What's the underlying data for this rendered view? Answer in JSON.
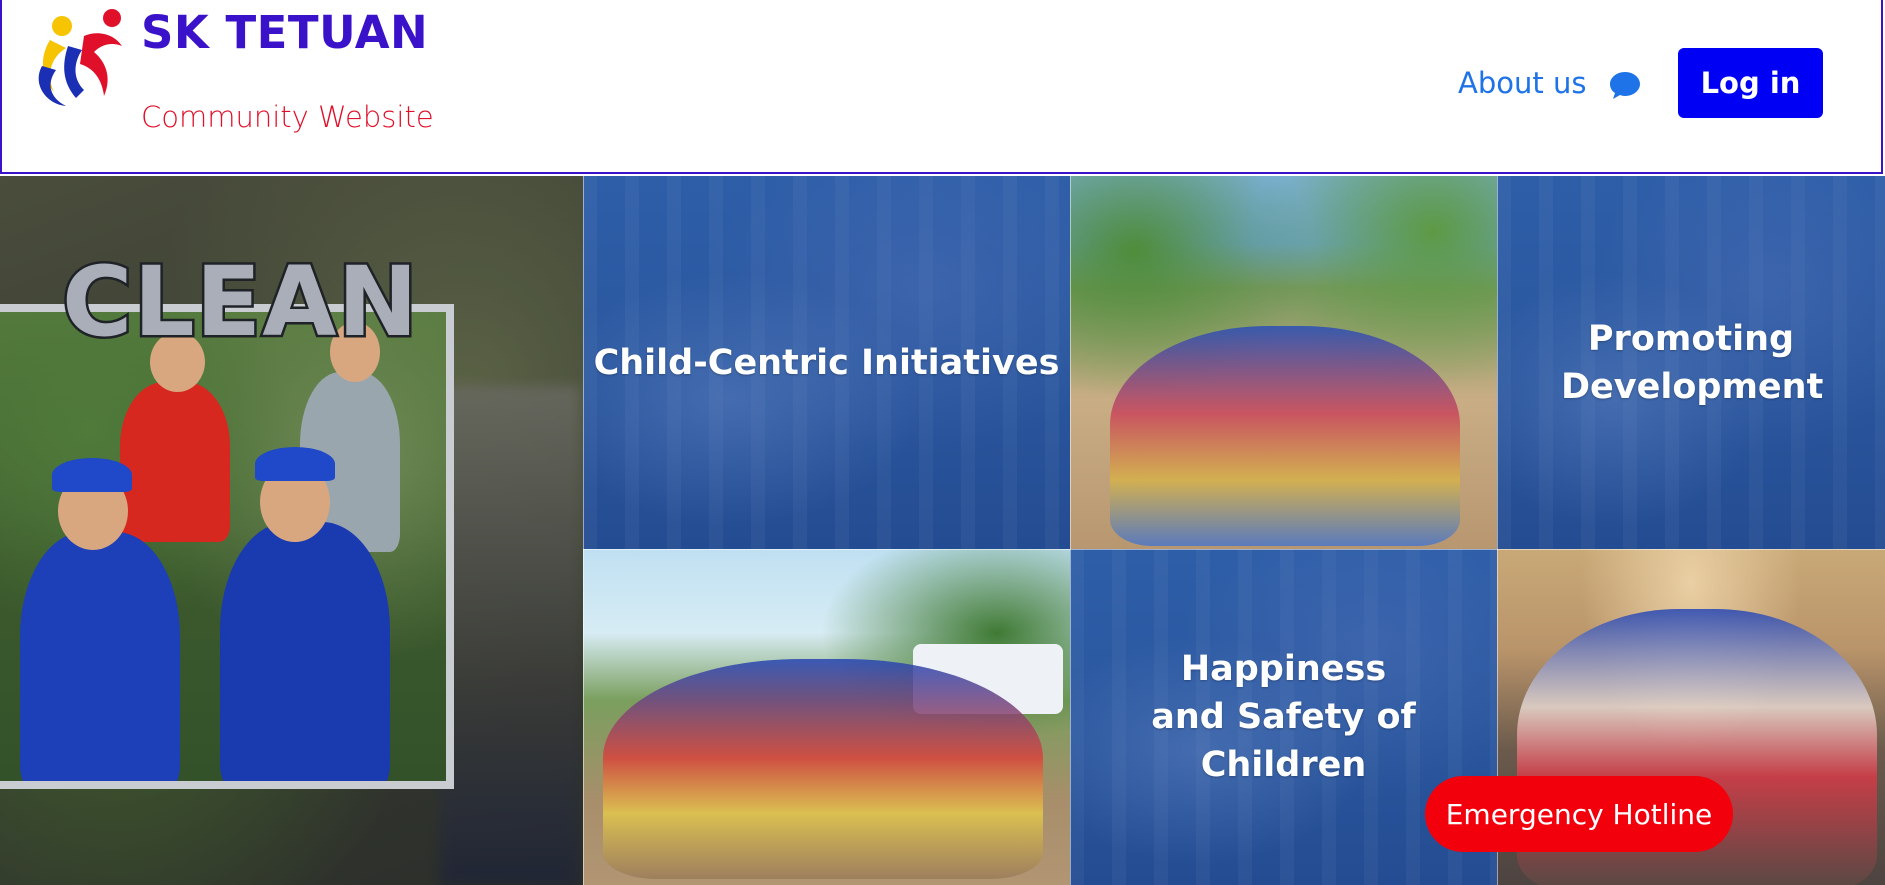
{
  "header": {
    "brand_title": "SK TETUAN",
    "brand_subtitle": "Community Website",
    "nav_about": "About us",
    "login_label": "Log in",
    "chat_icon": "chat-bubble-icon",
    "logo_icon": "sk-logo-figure-icon"
  },
  "hero": {
    "clean_word": "CLEAN",
    "tiles": [
      {
        "label": "Child-Centric Initiatives"
      },
      {
        "label": "Promoting Development"
      },
      {
        "label": "Happiness and Safety of Children"
      }
    ]
  },
  "floating": {
    "hotline_label": "Emergency Hotline"
  },
  "colors": {
    "brand_purple": "#3a12c9",
    "subtitle_red": "#e0102a",
    "link_blue": "#1e73e8",
    "login_blue": "#0000f5",
    "hotline_red": "#f2000c",
    "tile_overlay_blue": "#2a579f"
  }
}
